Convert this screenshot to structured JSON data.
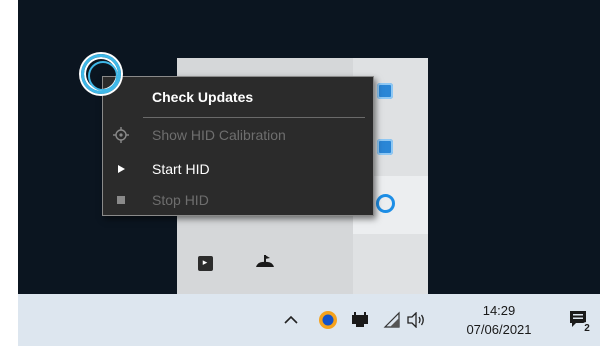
{
  "context_menu": {
    "items": [
      {
        "label": "Check Updates",
        "icon": "none",
        "enabled": true,
        "bold": true
      },
      {
        "label": "Show HID Calibration",
        "icon": "crosshair-icon",
        "enabled": false
      },
      {
        "label": "Start HID",
        "icon": "play-icon",
        "enabled": true
      },
      {
        "label": "Stop HID",
        "icon": "stop-icon",
        "enabled": false
      }
    ]
  },
  "taskbar": {
    "time": "14:29",
    "date": "07/06/2021",
    "notification_count": "2",
    "icons": [
      "chevron-up-icon",
      "bluetooth-icon",
      "battery-icon",
      "wifi-icon",
      "volume-icon",
      "notification-icon"
    ]
  },
  "tray_overflow": {
    "icons": [
      "blue-app-icon",
      "shield-app-icon",
      "circle-app-icon",
      "terminal-icon",
      "cloud-app-icon"
    ]
  },
  "colors": {
    "desktop": "#0b1520",
    "menu_bg": "#2b2b2b",
    "taskbar": "#dde6ef",
    "cursor_ring": "#3fb8e8"
  }
}
